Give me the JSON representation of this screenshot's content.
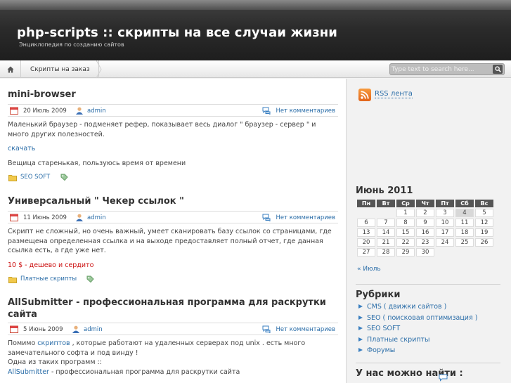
{
  "header": {
    "title": "php-scripts :: скрипты на все случаи жизни",
    "description": "Энциклопедия по созданию сайтов"
  },
  "nav": {
    "home_icon": "home-icon",
    "items": [
      {
        "label": "Скрипты на заказ"
      }
    ]
  },
  "search": {
    "placeholder": "Type text to search here...",
    "button_icon": "search-icon"
  },
  "posts": [
    {
      "title": "mini-browser",
      "date": "20 Июль 2009",
      "author": "admin",
      "comments": "Нет комментариев",
      "text1": "Маленький браузер - подменяет рефер, показывает весь диалог \" браузер - сервер \" и много других полезностей.",
      "link": "скачать",
      "text2": "Вещица старенькая, пользуюсь время от времени",
      "category": "SEO SOFT"
    },
    {
      "title": "Универсальный \" Чекер ссылок \"",
      "date": "11 Июнь 2009",
      "author": "admin",
      "comments": "Нет комментариев",
      "text1": "Скрипт не сложный, но очень важный, умеет сканировать базу ссылок со страницами, где размещена определенная ссылка и на выходе предоставляет полный отчет, где данная ссылка есть, а где уже нет.",
      "price": "10 $ - дешево и сердито",
      "category": "Платные скрипты"
    },
    {
      "title": "AllSubmitter - профессиональная программа для раскрутки сайта",
      "date": "5 Июнь 2009",
      "author": "admin",
      "comments": "Нет комментариев",
      "text_a": "Помимо ",
      "text_link": "скриптов",
      "text_b": " , которые работают на удаленных серверах под unix . есть много замечательного софта и под винду !",
      "text_c": "Одна из таких программ ::",
      "text_link2": "AllSubmitter",
      "text_d": " - профессиональная программа для раскрутки сайта"
    }
  ],
  "sidebar": {
    "rss_label": "RSS лента",
    "calendar": {
      "title": "Июнь 2011",
      "days": [
        "Пн",
        "Вт",
        "Ср",
        "Чт",
        "Пт",
        "Сб",
        "Вс"
      ],
      "weeks": [
        [
          "",
          "",
          "1",
          "2",
          "3",
          "4",
          "5"
        ],
        [
          "6",
          "7",
          "8",
          "9",
          "10",
          "11",
          "12"
        ],
        [
          "13",
          "14",
          "15",
          "16",
          "17",
          "18",
          "19"
        ],
        [
          "20",
          "21",
          "22",
          "23",
          "24",
          "25",
          "26"
        ],
        [
          "27",
          "28",
          "29",
          "30",
          "",
          "",
          ""
        ]
      ],
      "today": "4",
      "prev_link": "« Июль"
    },
    "categories": {
      "title": "Рубрики",
      "items": [
        "CMS ( движки сайтов )",
        "SEO ( поисковая оптимизация )",
        "SEO SOFT",
        "Платные скрипты",
        "Форумы"
      ]
    },
    "find_title": "У нас можно найти :"
  }
}
